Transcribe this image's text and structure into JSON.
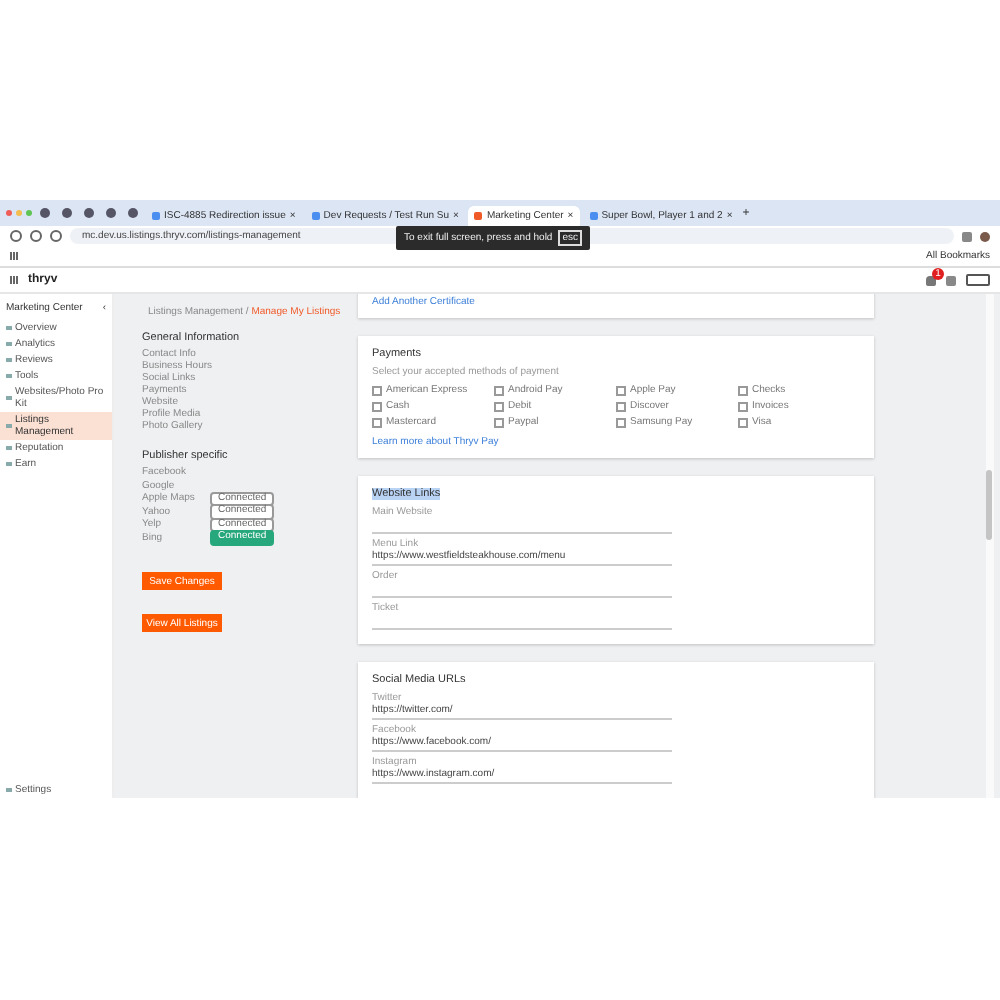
{
  "browser": {
    "tabs": [
      {
        "label": "ISC-4885 Redirection issue",
        "selected": false,
        "close": "×"
      },
      {
        "label": "Dev Requests / Test Run Su",
        "selected": false,
        "close": "×"
      },
      {
        "label": "Marketing Center",
        "selected": true,
        "close": "×"
      },
      {
        "label": "Super Bowl, Player 1 and 2",
        "selected": false,
        "close": "×"
      }
    ],
    "new_tab": "+",
    "url": "mc.dev.us.listings.thryv.com/listings-management",
    "bookmarks": "All Bookmarks",
    "tooltip": {
      "text": "To exit full screen, press and hold",
      "key": "esc"
    }
  },
  "app": {
    "logo": "thryv",
    "sidebar": {
      "title": "Marketing Center",
      "collapse": "‹",
      "items": [
        {
          "label": "Overview",
          "selected": false
        },
        {
          "label": "Analytics",
          "selected": false
        },
        {
          "label": "Reviews",
          "selected": false
        },
        {
          "label": "Tools",
          "selected": false
        },
        {
          "label": "Websites/Photo Pro Kit",
          "selected": false
        },
        {
          "label": "Listings Management",
          "selected": true
        },
        {
          "label": "Reputation",
          "selected": false
        },
        {
          "label": "Earn",
          "selected": false
        }
      ],
      "settings": "Settings"
    },
    "notifications": "1"
  },
  "breadcrumb": {
    "parent": "Listings Management",
    "separator": "/",
    "current": "Manage My Listings"
  },
  "general": {
    "title": "General Information",
    "items": [
      "Contact Info",
      "Business Hours",
      "Social Links",
      "Payments",
      "Website",
      "Profile Media",
      "Photo Gallery"
    ]
  },
  "publisher": {
    "title": "Publisher specific",
    "items": [
      {
        "name": "Facebook"
      },
      {
        "name": "Google"
      },
      {
        "name": "Apple Maps",
        "badge": "Connected",
        "kind": "grey"
      },
      {
        "name": "Yahoo",
        "badge": "Connected",
        "kind": "grey"
      },
      {
        "name": "Yelp",
        "badge": "Connected",
        "kind": "grey"
      },
      {
        "name": "Bing",
        "badge": "Connected",
        "kind": "green"
      }
    ]
  },
  "buttons": [
    "Save Changes",
    "View All Listings"
  ],
  "certificates": {
    "link": "Add Another Certificate"
  },
  "payments": {
    "title": "Payments",
    "hint": "Select your accepted methods of payment",
    "options": [
      {
        "label": "American Express",
        "checked": false
      },
      {
        "label": "Android Pay",
        "checked": false
      },
      {
        "label": "Apple Pay",
        "checked": false
      },
      {
        "label": "Checks",
        "checked": false
      },
      {
        "label": "Cash",
        "checked": false
      },
      {
        "label": "Debit",
        "checked": false
      },
      {
        "label": "Discover",
        "checked": false
      },
      {
        "label": "Invoices",
        "checked": false
      },
      {
        "label": "Mastercard",
        "checked": false
      },
      {
        "label": "Paypal",
        "checked": false
      },
      {
        "label": "Samsung Pay",
        "checked": false
      },
      {
        "label": "Visa",
        "checked": false
      }
    ],
    "link": "Learn more about Thryv Pay"
  },
  "website": {
    "title": "Website Links",
    "fields": [
      {
        "label": "Main Website"
      },
      {
        "label": "Menu Link",
        "value": "https://www.westfieldsteakhouse.com/menu"
      },
      {
        "label": "Order"
      },
      {
        "label": "Ticket"
      }
    ]
  },
  "social": {
    "title": "Social Media URLs",
    "fields": [
      {
        "label": "Twitter",
        "value": "https://twitter.com/"
      },
      {
        "label": "Facebook",
        "value": "https://www.facebook.com/"
      },
      {
        "label": "Instagram",
        "value": "https://www.instagram.com/"
      }
    ]
  }
}
